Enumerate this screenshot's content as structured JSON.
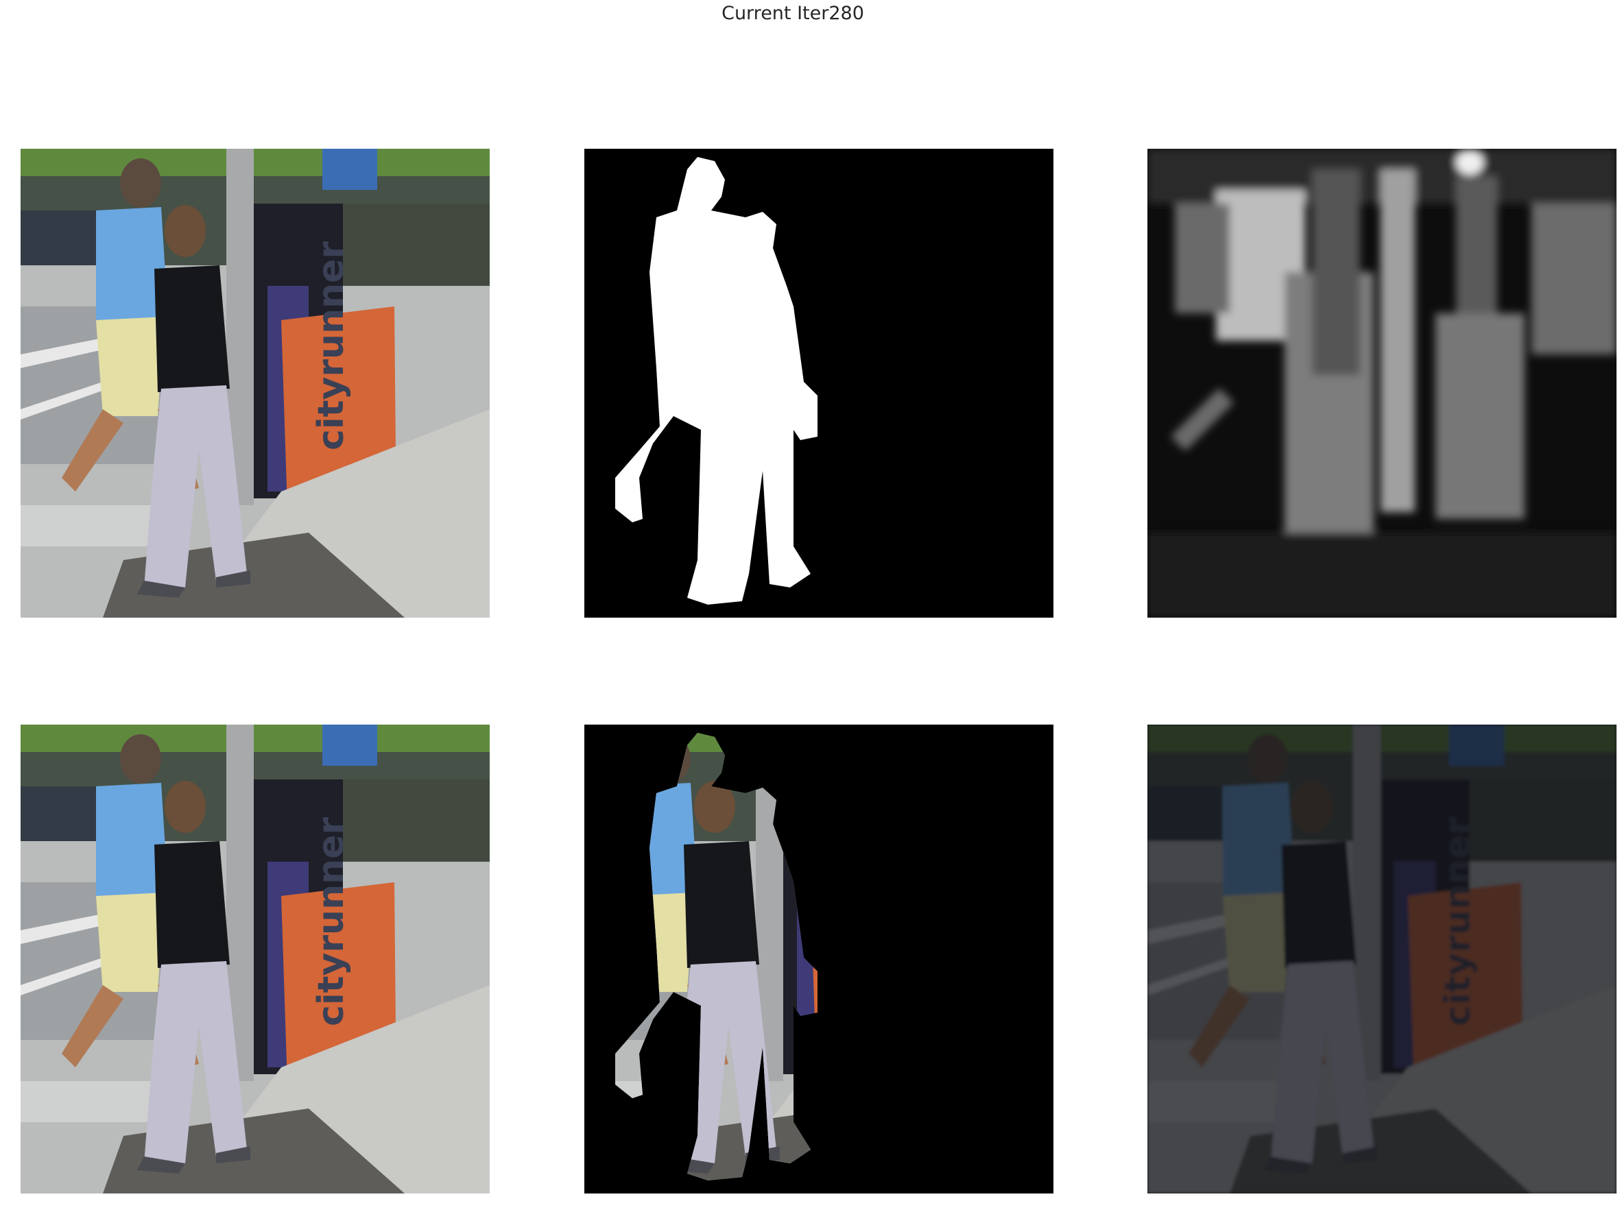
{
  "figure": {
    "title": "Current Iter280"
  },
  "panels": [
    {
      "row": 1,
      "col": 1,
      "content": "input-image"
    },
    {
      "row": 1,
      "col": 2,
      "content": "ground-truth-mask"
    },
    {
      "row": 1,
      "col": 3,
      "content": "predicted-saliency-map"
    },
    {
      "row": 2,
      "col": 1,
      "content": "input-image"
    },
    {
      "row": 2,
      "col": 2,
      "content": "masked-foreground"
    },
    {
      "row": 2,
      "col": 3,
      "content": "predicted-foreground-composite"
    }
  ],
  "sign_text": "cityrunner"
}
